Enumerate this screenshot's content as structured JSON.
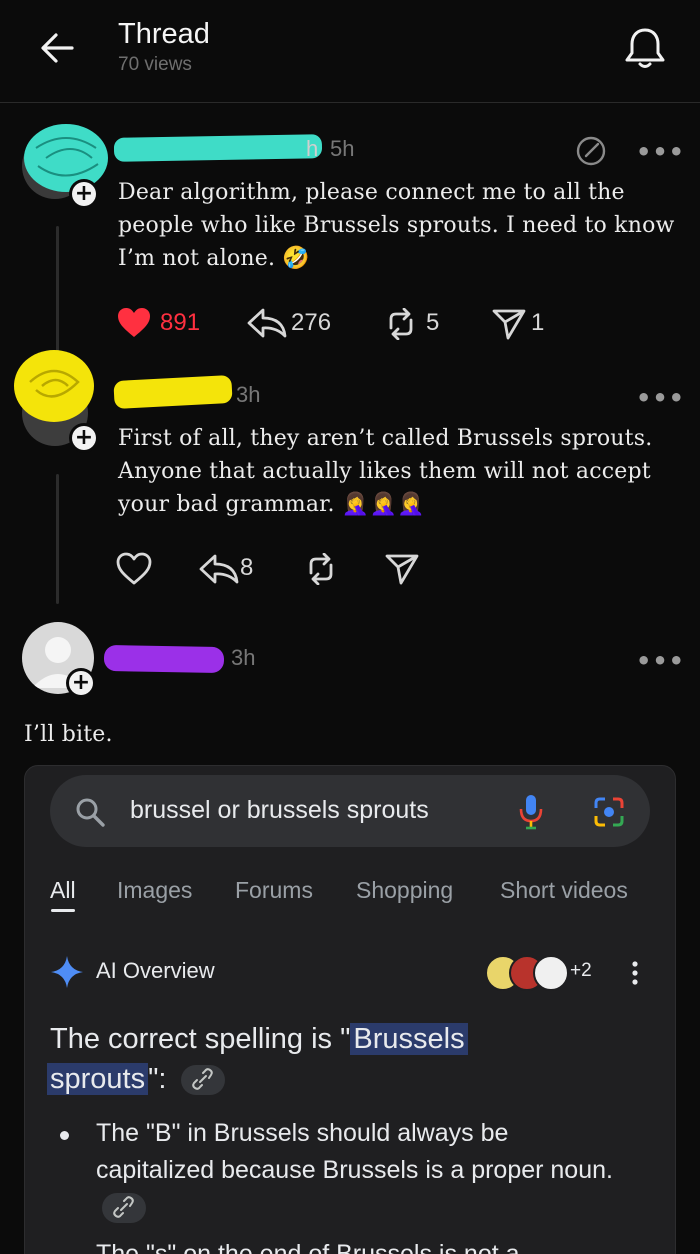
{
  "header": {
    "title": "Thread",
    "views": "70 views"
  },
  "posts": [
    {
      "time": "5h",
      "username_partial": "h",
      "text": "Dear algorithm, please connect me to all the people who like Brussels  sprouts. I need to know I’m not alone. 🤣",
      "likes": "891",
      "replies": "276",
      "reposts": "5",
      "shares": "1"
    },
    {
      "time": "3h",
      "text": "First of all, they aren’t called Brussels sprouts. Anyone that actually likes them will not accept your bad grammar. 🤦‍♀️🤦‍♀️🤦‍♀️",
      "replies": "8"
    },
    {
      "time": "3h",
      "text": "I’ll bite."
    }
  ],
  "google": {
    "query": "brussel or brussels sprouts",
    "tabs": [
      "All",
      "Images",
      "Forums",
      "Shopping",
      "Short videos"
    ],
    "ai_overview_label": "AI Overview",
    "sources_more": "+2",
    "answer_prefix": "The correct spelling is \"",
    "answer_highlight_1": "Brussels",
    "answer_highlight_2": "sprouts",
    "answer_suffix": "\":",
    "bullet_1": "The \"B\" in Brussels should always be capitalized because Brussels is a proper noun.",
    "bullet_2_partial": "The \"s\" on the end of Brussels is not a"
  },
  "colors": {
    "background": "#0b0b0b",
    "like_red": "#ff3040",
    "redact_teal": "#3fdcc7",
    "redact_yellow": "#f4e40a",
    "redact_purple": "#9b30e8",
    "google_card": "#1f1f21",
    "highlight": "#2b3b6b"
  }
}
